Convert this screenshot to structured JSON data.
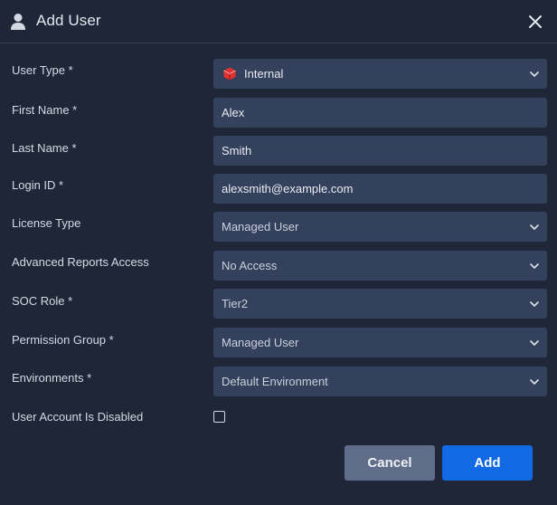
{
  "dialog": {
    "title": "Add User",
    "icons": {
      "header": "user-icon",
      "close": "close-icon",
      "chevron": "chevron-down-icon",
      "internal": "internal-cube-icon"
    },
    "colors": {
      "background": "#1e2638",
      "field": "#34415c",
      "primary": "#1169e3",
      "secondary": "#5f6d89",
      "internal_logo": "#e0302f"
    }
  },
  "form": {
    "user_type": {
      "label": "User Type *",
      "value": "Internal"
    },
    "first_name": {
      "label": "First Name *",
      "value": "Alex"
    },
    "last_name": {
      "label": "Last Name *",
      "value": "Smith"
    },
    "login_id": {
      "label": "Login ID *",
      "value": "alexsmith@example.com"
    },
    "license_type": {
      "label": "License Type",
      "value": "Managed User"
    },
    "advanced_reports": {
      "label": "Advanced Reports Access",
      "value": "No Access"
    },
    "soc_role": {
      "label": "SOC Role *",
      "value": "Tier2"
    },
    "permission_group": {
      "label": "Permission Group *",
      "value": "Managed User"
    },
    "environments": {
      "label": "Environments *",
      "value": "Default Environment"
    },
    "disabled": {
      "label": "User Account Is Disabled",
      "checked": false
    }
  },
  "actions": {
    "cancel": "Cancel",
    "add": "Add"
  }
}
